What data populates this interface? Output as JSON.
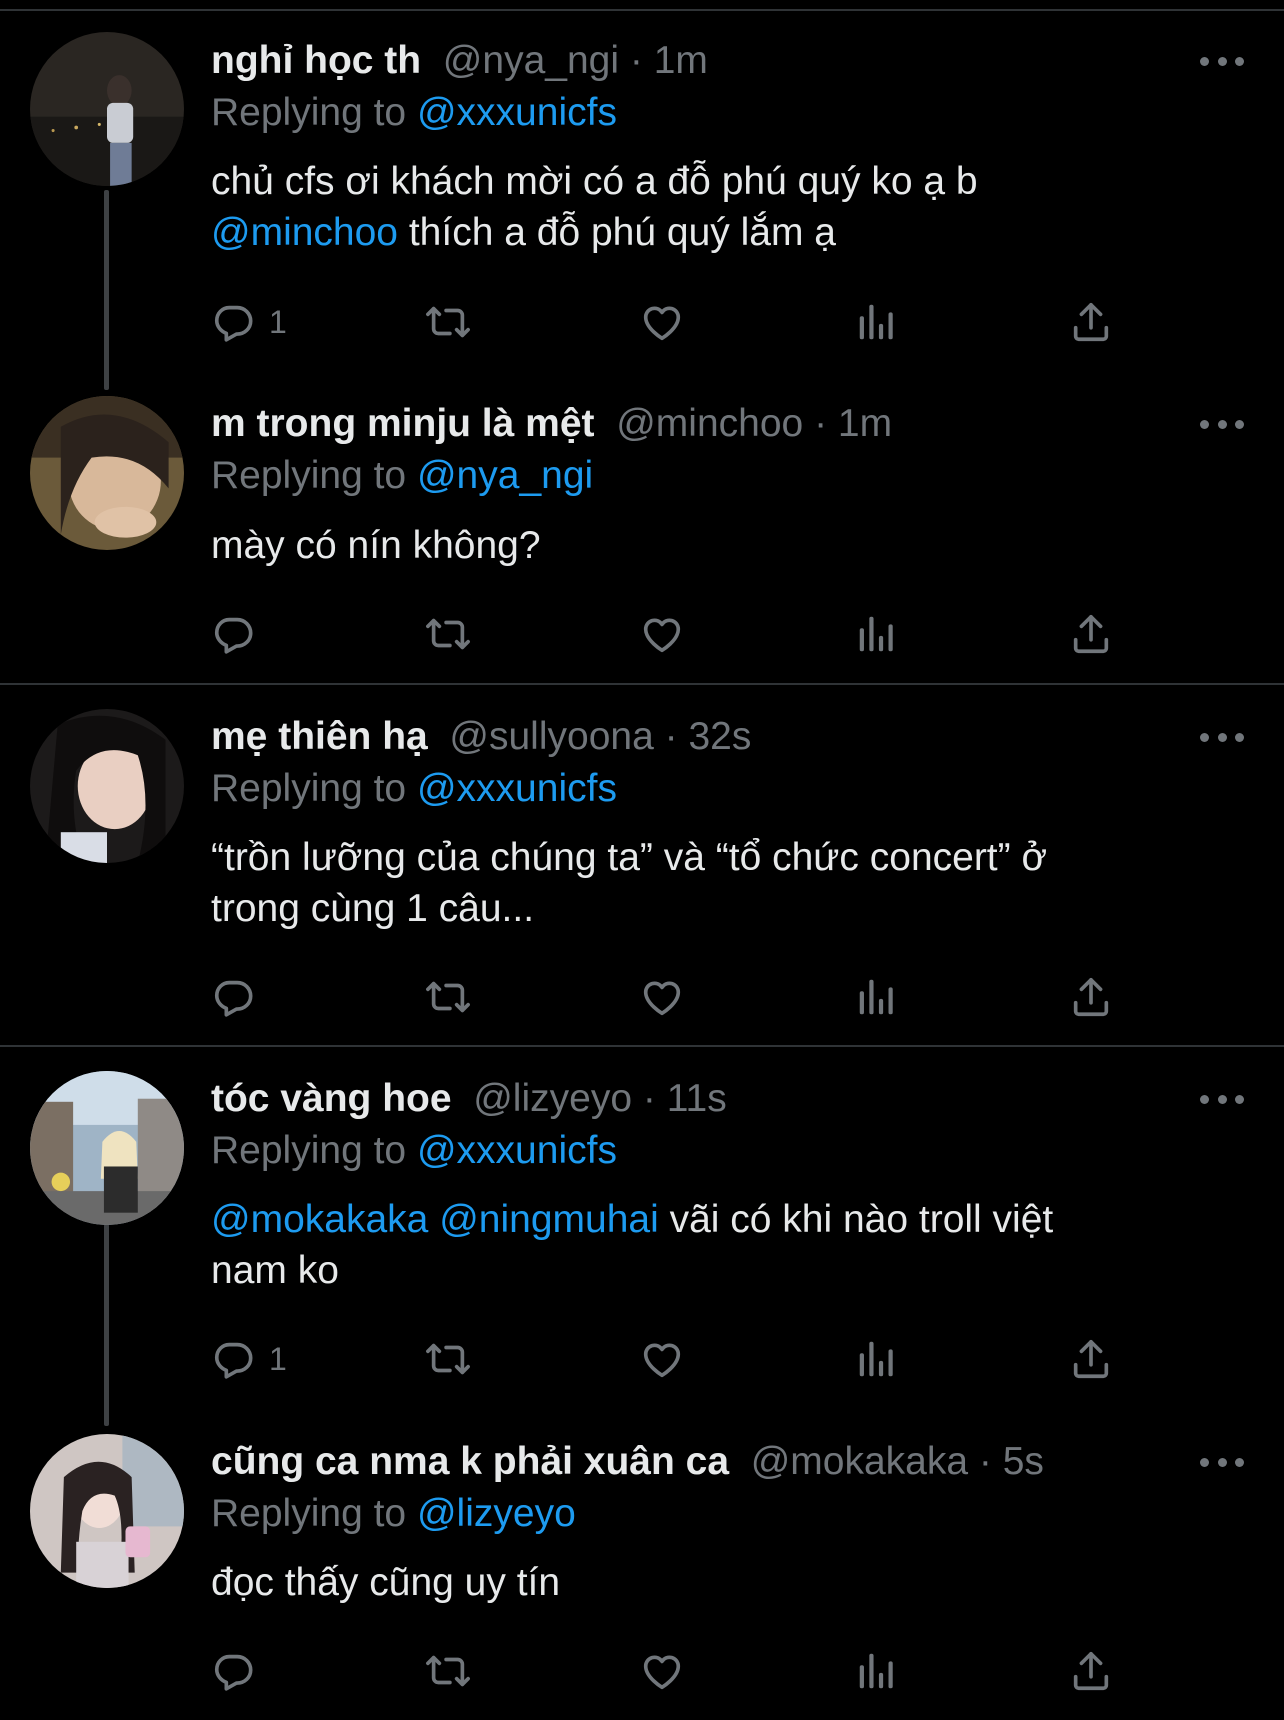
{
  "theme": {
    "background": "#000000",
    "text": "#e7e9ea",
    "muted": "#71767b",
    "link": "#1d9bf0",
    "divider": "#2f3336"
  },
  "tweets": [
    {
      "name": "nghỉ học th",
      "handle": "@nya_ngi",
      "time": "1m",
      "replying_label": "Replying to",
      "replying_to": "@xxxunicfs",
      "text_line1": "chủ cfs ơi khách mời có a đỗ phú quý ko ạ b",
      "mention1": "@minchoo",
      "text_line2": " thích a đỗ phú quý lắm ạ",
      "reply_count": "1",
      "icons": {
        "reply": "reply-icon",
        "retweet": "retweet-icon",
        "like": "heart-icon",
        "views": "views-icon",
        "share": "share-icon",
        "more": "more-icon"
      }
    },
    {
      "name": "m trong minju là mệt",
      "handle": "@minchoo",
      "time": "1m",
      "replying_label": "Replying to",
      "replying_to": "@nya_ngi",
      "text": "mày có nín không?",
      "reply_count": ""
    },
    {
      "name": "mẹ thiên hạ",
      "handle": "@sullyoona",
      "time": "32s",
      "replying_label": "Replying to",
      "replying_to": "@xxxunicfs",
      "text_line1": "“trồn lưỡng của chúng ta” và “tổ chức concert” ở",
      "text_line2": "trong cùng 1 câu...",
      "reply_count": ""
    },
    {
      "name": "tóc vàng hoe",
      "handle": "@lizyeyo",
      "time": "11s",
      "replying_label": "Replying to",
      "replying_to": "@xxxunicfs",
      "mention1": "@mokakaka",
      "mention2": "@ningmuhai",
      "text_line1": " vãi có khi nào troll việt",
      "text_line2": "nam ko",
      "reply_count": "1"
    },
    {
      "name": "cũng ca nma k phải xuân ca",
      "handle": "@mokakaka",
      "time": "5s",
      "replying_label": "Replying to",
      "replying_to": "@lizyeyo",
      "text": "đọc thấy cũng uy tín",
      "reply_count": ""
    }
  ]
}
